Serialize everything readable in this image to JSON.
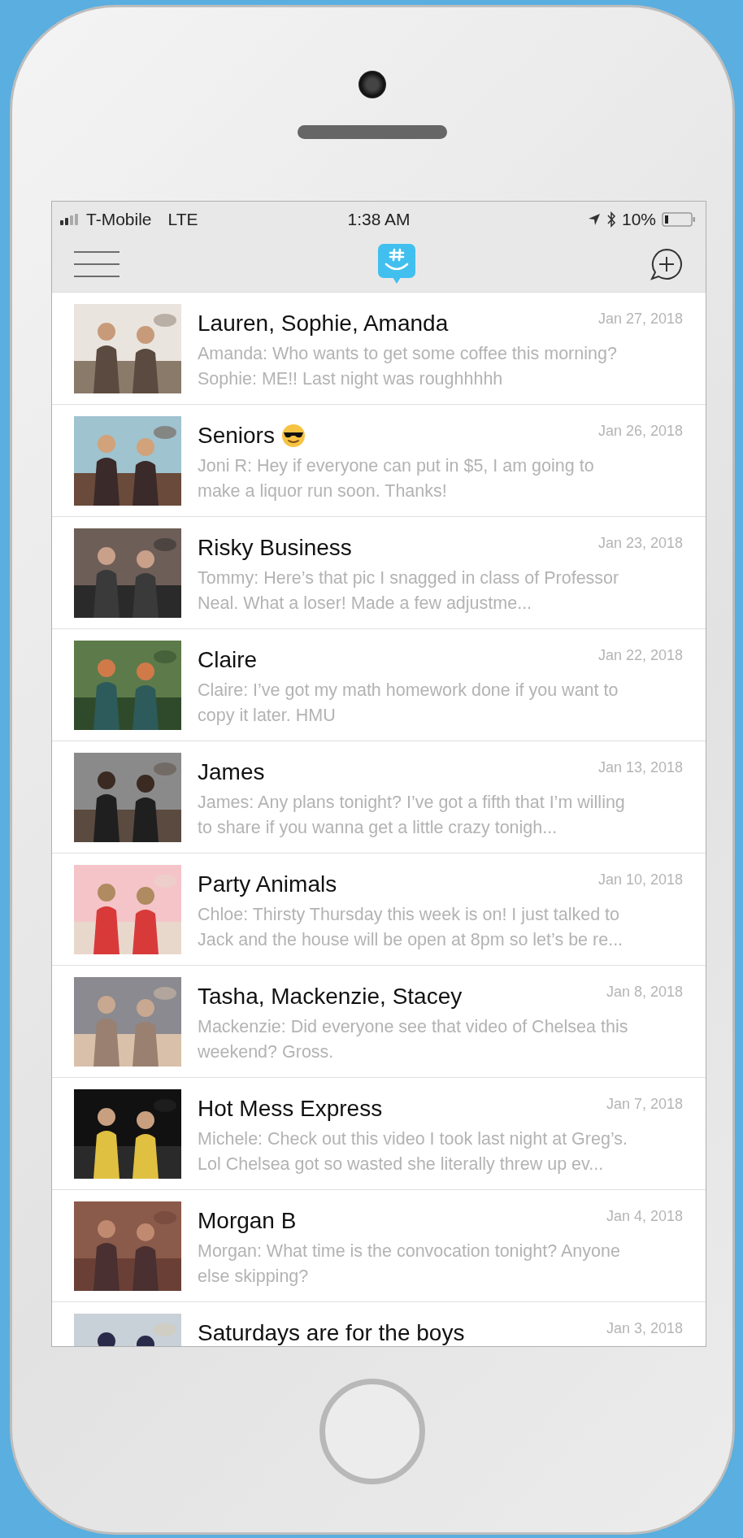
{
  "status_bar": {
    "carrier": "T-Mobile",
    "network": "LTE",
    "time": "1:38 AM",
    "battery": "10%"
  },
  "conversations": [
    {
      "title": "Lauren, Sophie, Amanda",
      "date": "Jan 27, 2018",
      "preview": "Amanda: Who wants to get some coffee this morning? Sophie: ME!! Last night was roughhhhh",
      "kind": "picture"
    },
    {
      "title": "Seniors",
      "emoji_icon": true,
      "date": "Jan 26, 2018",
      "preview": "Joni R: Hey if everyone can put in $5, I am going to make a liquor run soon. Thanks!",
      "kind": "picture"
    },
    {
      "title": "Risky Business",
      "date": "Jan 23, 2018",
      "preview": "Tommy: Here’s that pic I snagged in class of Professor Neal. What a loser! Made a few adjustme...",
      "kind": "picture"
    },
    {
      "title": "Claire",
      "date": "Jan 22, 2018",
      "preview": "Claire: I’ve got my math homework done if you want to copy it later. HMU",
      "kind": "picture"
    },
    {
      "title": "James",
      "date": "Jan 13, 2018",
      "preview": "James: Any plans tonight? I’ve got a fifth that I’m willing to share if you wanna get a little crazy tonigh...",
      "kind": "picture"
    },
    {
      "title": "Party Animals",
      "date": "Jan 10, 2018",
      "preview": "Chloe: Thirsty Thursday this week is on! I just talked to Jack and the house will be open at 8pm so let’s be re...",
      "kind": "picture"
    },
    {
      "title": "Tasha, Mackenzie, Stacey",
      "date": "Jan 8, 2018",
      "preview": "Mackenzie: Did everyone see that video of Chelsea this weekend? Gross.",
      "kind": "picture"
    },
    {
      "title": "Hot Mess Express",
      "date": "Jan 7, 2018",
      "preview": "Michele: Check out this video I took last night at Greg’s. Lol Chelsea got so wasted she literally threw up ev...",
      "kind": "picture"
    },
    {
      "title": "Morgan B",
      "date": "Jan 4, 2018",
      "preview": "Morgan: What time is the convocation tonight? Anyone else skipping?",
      "kind": "picture"
    },
    {
      "title": "Saturdays are for the boys",
      "date": "Jan 3, 2018",
      "kind": "picture"
    }
  ]
}
